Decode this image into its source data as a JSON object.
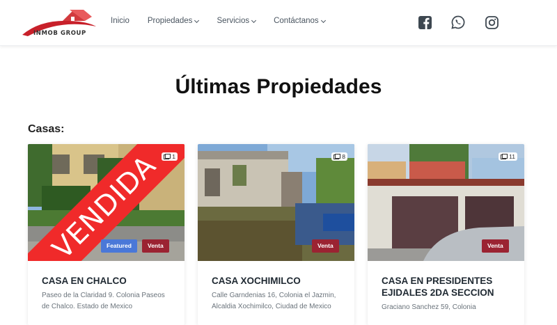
{
  "brand": {
    "name": "INMOB GROUP"
  },
  "nav": [
    {
      "label": "Inicio",
      "dropdown": false
    },
    {
      "label": "Propiedades",
      "dropdown": true
    },
    {
      "label": "Servicios",
      "dropdown": true
    },
    {
      "label": "Contáctanos",
      "dropdown": true
    }
  ],
  "social_icons": [
    "facebook-icon",
    "whatsapp-icon",
    "instagram-icon"
  ],
  "page_title": "Últimas Propiedades",
  "section_label": "Casas:",
  "listings": [
    {
      "title": "CASA EN CHALCO",
      "address": "Paseo de la Claridad 9. Colonia Paseos de Chalco. Estado de Mexico",
      "photos": "1",
      "status": "Venta",
      "featured": "Featured",
      "sold": "VENDIDA"
    },
    {
      "title": "CASA XOCHIMILCO",
      "address": "Calle Garndenias 16, Colonia el Jazmin, Alcaldia Xochimilco, Ciudad de Mexico",
      "photos": "8",
      "status": "Venta"
    },
    {
      "title": "CASA EN PRESIDENTES EJIDALES 2DA SECCION",
      "address": "Graciano Sanchez 59, Colonia",
      "photos": "11",
      "status": "Venta"
    }
  ],
  "colors": {
    "sale_badge": "#9b2332",
    "featured_badge": "#4a78d8",
    "sold_banner": "#f02a2a",
    "logo_red": "#c8202a"
  }
}
